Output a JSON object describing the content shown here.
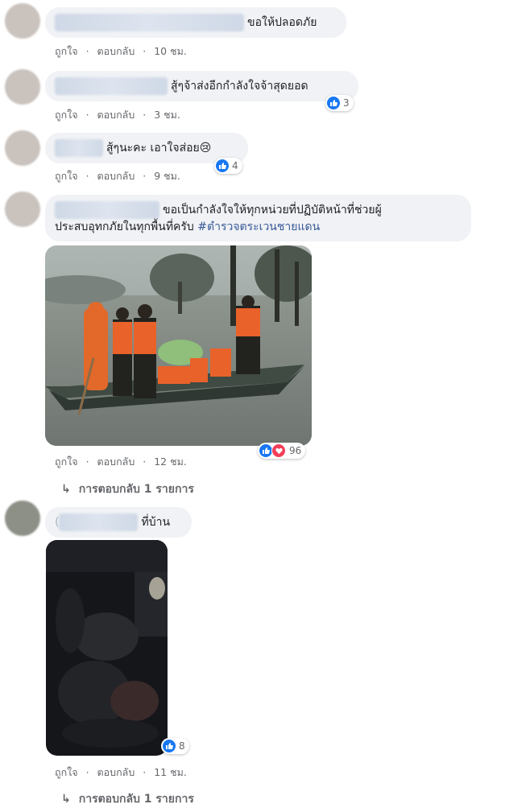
{
  "comments": [
    {
      "text": "ขอให้ปลอดภัย",
      "actions": {
        "like": "ถูกใจ",
        "dot": "·",
        "reply": "ตอบกลับ",
        "time": "10 ชม."
      }
    },
    {
      "text": "สู้ๆจ้าส่งอีกกำลังใจจ้าสุดยอด",
      "reaction_count": "3",
      "actions": {
        "like": "ถูกใจ",
        "dot": "·",
        "reply": "ตอบกลับ",
        "time": "3 ชม."
      }
    },
    {
      "text": "สู้ๆนะคะ เอาใจส่อย😢",
      "reaction_count": "4",
      "actions": {
        "like": "ถูกใจ",
        "dot": "·",
        "reply": "ตอบกลับ",
        "time": "9 ชม."
      }
    },
    {
      "text_line1": "ขอเป็นกำลังใจให้ทุกหน่วยที่ปฏิบัติหน้าที่ช่วยผู้",
      "text_line2": "ประสบอุทกภัยในทุกพื้นที่ครับ ",
      "hashtag": "#ตำรวจตระเวนชายแดน",
      "reaction_count": "96",
      "actions": {
        "like": "ถูกใจ",
        "dot": "·",
        "reply": "ตอบกลับ",
        "time": "12 ชม."
      },
      "replies": "การตอบกลับ 1 รายการ"
    },
    {
      "text": "ที่บ้าน",
      "prefix": "(",
      "reaction_count": "8",
      "actions": {
        "like": "ถูกใจ",
        "dot": "·",
        "reply": "ตอบกลับ",
        "time": "11 ชม."
      },
      "replies": "การตอบกลับ 1 รายการ"
    }
  ],
  "icons": {
    "like": "thumbs-up-icon",
    "love": "heart-icon",
    "reply_arrow": "reply-arrow-icon"
  },
  "colors": {
    "like_blue": "#1877f2",
    "love_red": "#f33e58",
    "bubble": "#f0f2f5",
    "meta_gray": "#65676b"
  }
}
